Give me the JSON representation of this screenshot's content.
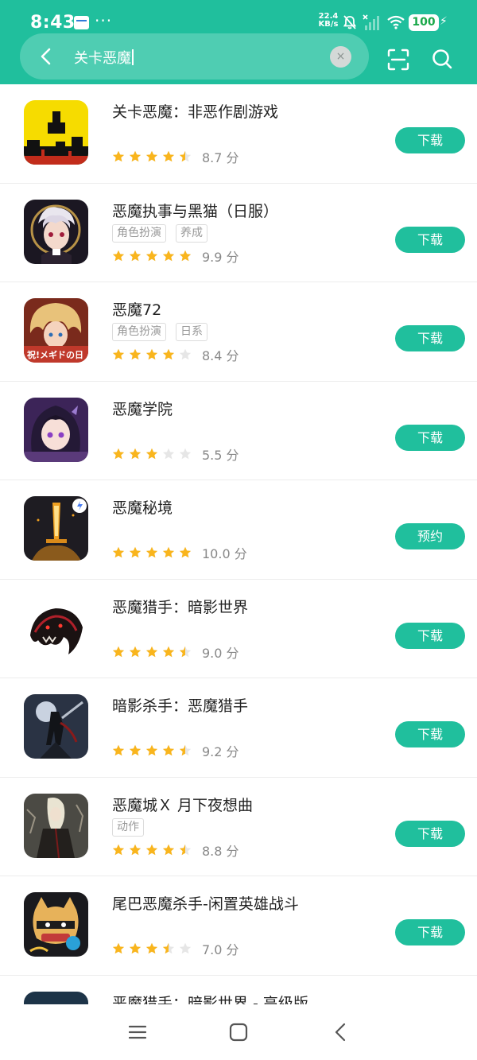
{
  "status_bar": {
    "time": "8:43",
    "speed_value": "22.4",
    "speed_unit": "KB/s",
    "battery": "100"
  },
  "search": {
    "query": "关卡恶魔",
    "clear_label": "×"
  },
  "colors": {
    "accent": "#20bf9d",
    "star_filled": "#f9b51d",
    "star_empty": "#e6e6e6"
  },
  "apps": [
    {
      "name": "关卡恶魔：非恶作剧游戏",
      "tags": [],
      "stars": 4.5,
      "score": "8.7 分",
      "button": "下载"
    },
    {
      "name": "恶魔执事与黑猫（日服）",
      "tags": [
        "角色扮演",
        "养成"
      ],
      "stars": 5,
      "score": "9.9 分",
      "button": "下载"
    },
    {
      "name": "恶魔72",
      "tags": [
        "角色扮演",
        "日系"
      ],
      "stars": 4,
      "score": "8.4 分",
      "button": "下载"
    },
    {
      "name": "恶魔学院",
      "tags": [],
      "stars": 3,
      "score": "5.5 分",
      "button": "下载"
    },
    {
      "name": "恶魔秘境",
      "tags": [],
      "stars": 5,
      "score": "10.0 分",
      "button": "预约"
    },
    {
      "name": "恶魔猎手：暗影世界",
      "tags": [],
      "stars": 4.5,
      "score": "9.0 分",
      "button": "下载"
    },
    {
      "name": "暗影杀手：恶魔猎手",
      "tags": [],
      "stars": 4.5,
      "score": "9.2 分",
      "button": "下载"
    },
    {
      "name": "恶魔城Ｘ 月下夜想曲",
      "tags": [
        "动作"
      ],
      "stars": 4.5,
      "score": "8.8 分",
      "button": "下载"
    },
    {
      "name": "尾巴恶魔杀手-闲置英雄战斗",
      "tags": [],
      "stars": 3.5,
      "score": "7.0 分",
      "button": "下载"
    },
    {
      "name": "恶魔猎手：暗影世界 - 高级版",
      "tags": [],
      "stars": 0,
      "score": "",
      "button": ""
    }
  ]
}
